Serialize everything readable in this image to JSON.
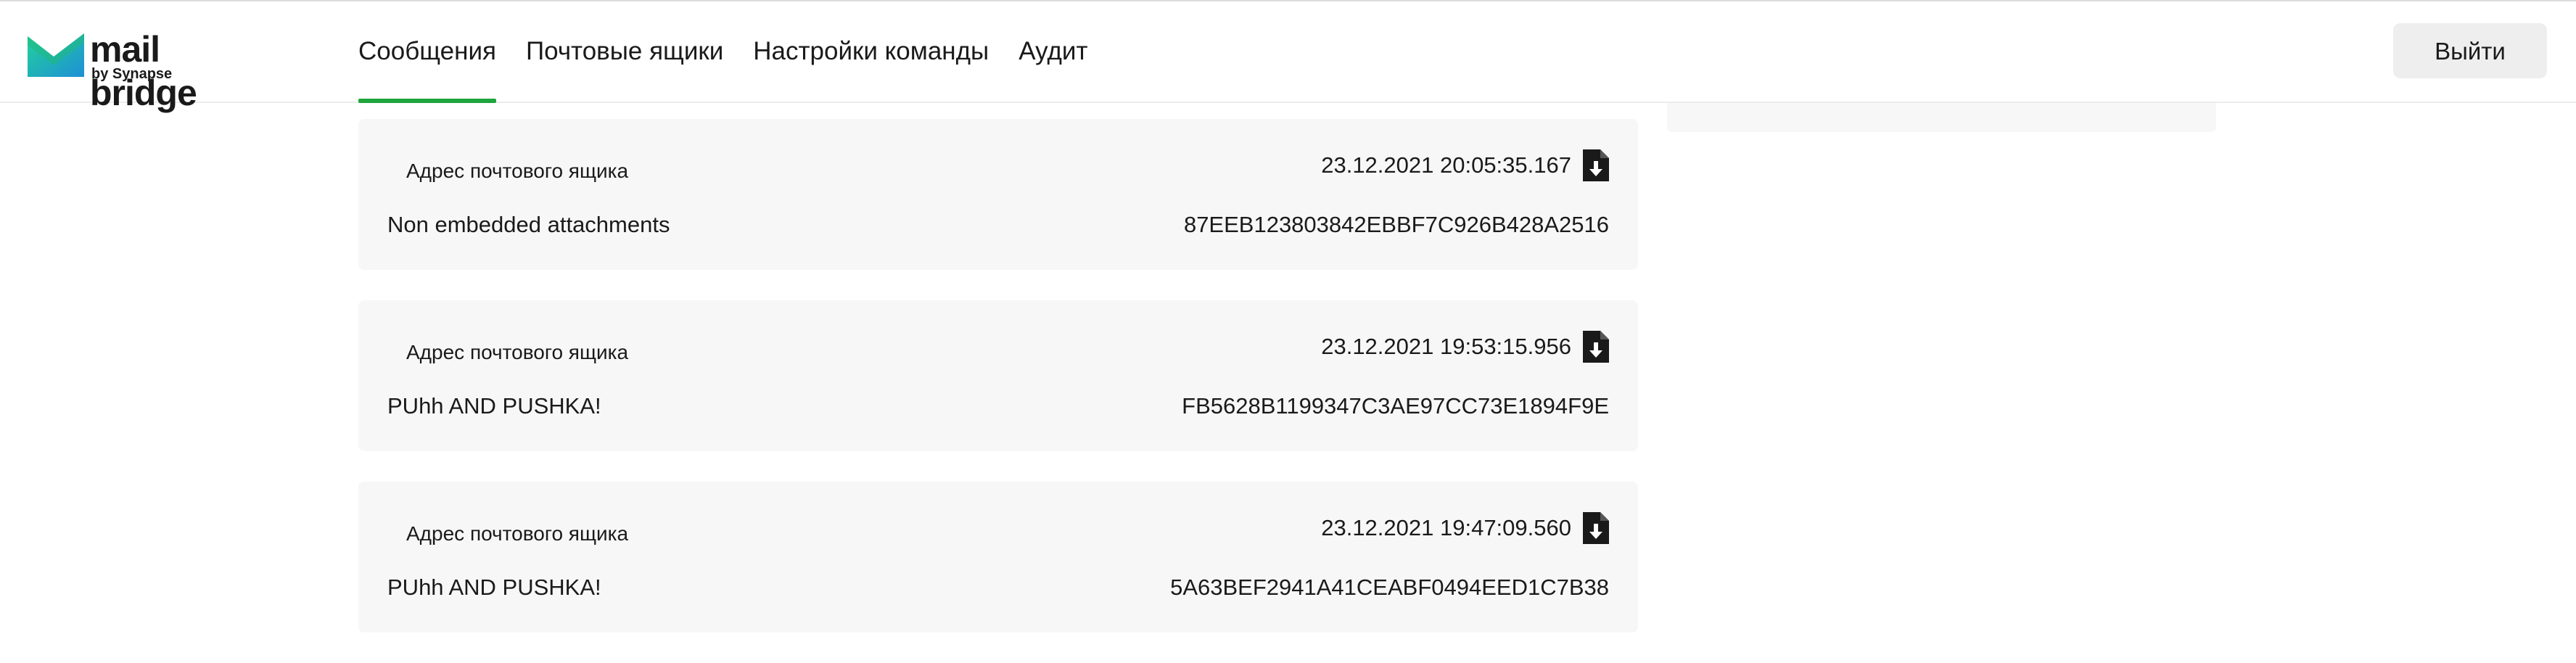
{
  "app": {
    "logo_title": "mail bridge",
    "logo_subtitle": "by Synapse",
    "brand_colors": {
      "primary": "#1ea53d",
      "logo_gradient_start": "#22d39a",
      "logo_gradient_end": "#1e8fd6"
    }
  },
  "nav": {
    "items": [
      {
        "label": "Сообщения",
        "active": true
      },
      {
        "label": "Почтовые ящики",
        "active": false
      },
      {
        "label": "Настройки команды",
        "active": false
      },
      {
        "label": "Аудит",
        "active": false
      }
    ],
    "logout_label": "Выйти"
  },
  "messages": [
    {
      "label": "Адрес почтового ящика",
      "timestamp": "23.12.2021 20:05:35.167",
      "subject": "Non embedded attachments",
      "id": "87EEB123803842EBBF7C926B428A2516",
      "icon": "file-download-icon"
    },
    {
      "label": "Адрес почтового ящика",
      "timestamp": "23.12.2021 19:53:15.956",
      "subject": "PUhh AND PUSHKA!",
      "id": "FB5628B1199347C3AE97CC73E1894F9E",
      "icon": "file-download-icon"
    },
    {
      "label": "Адрес почтового ящика",
      "timestamp": "23.12.2021 19:47:09.560",
      "subject": "PUhh AND PUSHKA!",
      "id": "5A63BEF2941A41CEABF0494EED1C7B38",
      "icon": "file-download-icon"
    }
  ]
}
